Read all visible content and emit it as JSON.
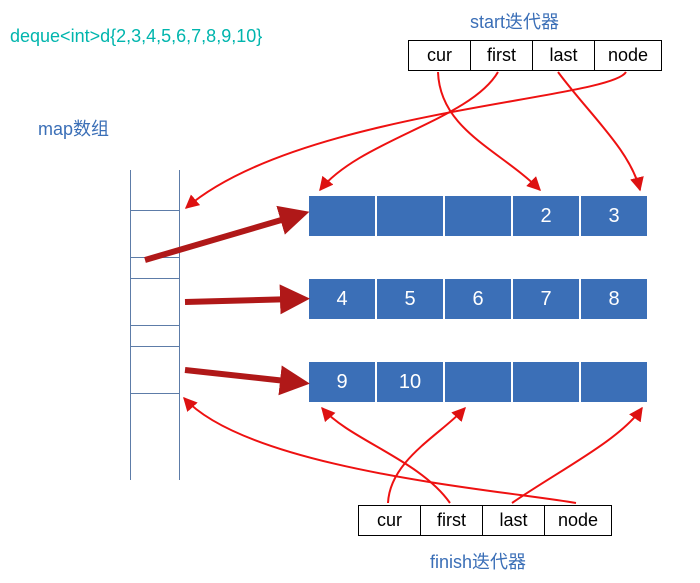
{
  "title_code": "deque<int>d{2,3,4,5,6,7,8,9,10}",
  "labels": {
    "map_array": "map数组",
    "start_iter": "start迭代器",
    "finish_iter": "finish迭代器"
  },
  "iterator_fields": {
    "cur": "cur",
    "first": "first",
    "last": "last",
    "node": "node"
  },
  "buffers": [
    {
      "cells": [
        "",
        "",
        "",
        "2",
        "3"
      ]
    },
    {
      "cells": [
        "4",
        "5",
        "6",
        "7",
        "8"
      ]
    },
    {
      "cells": [
        "9",
        "10",
        "",
        "",
        ""
      ]
    }
  ],
  "chart_data": {
    "type": "table",
    "title": "STL deque internal structure",
    "deque_values": [
      2,
      3,
      4,
      5,
      6,
      7,
      8,
      9,
      10
    ],
    "buffer_size": 5,
    "map_slots_shown": 3,
    "buffers": [
      [
        null,
        null,
        null,
        2,
        3
      ],
      [
        4,
        5,
        6,
        7,
        8
      ],
      [
        9,
        10,
        null,
        null,
        null
      ]
    ],
    "iterators": {
      "start": {
        "fields": [
          "cur",
          "first",
          "last",
          "node"
        ],
        "points_to": {
          "cur": "buffers[0][3]",
          "first": "buffers[0][0]",
          "last": "buffers[0][end]",
          "node": "map[0]"
        }
      },
      "finish": {
        "fields": [
          "cur",
          "first",
          "last",
          "node"
        ],
        "points_to": {
          "cur": "buffers[2][2]",
          "first": "buffers[2][0]",
          "last": "buffers[2][end]",
          "node": "map[2]"
        }
      }
    }
  }
}
